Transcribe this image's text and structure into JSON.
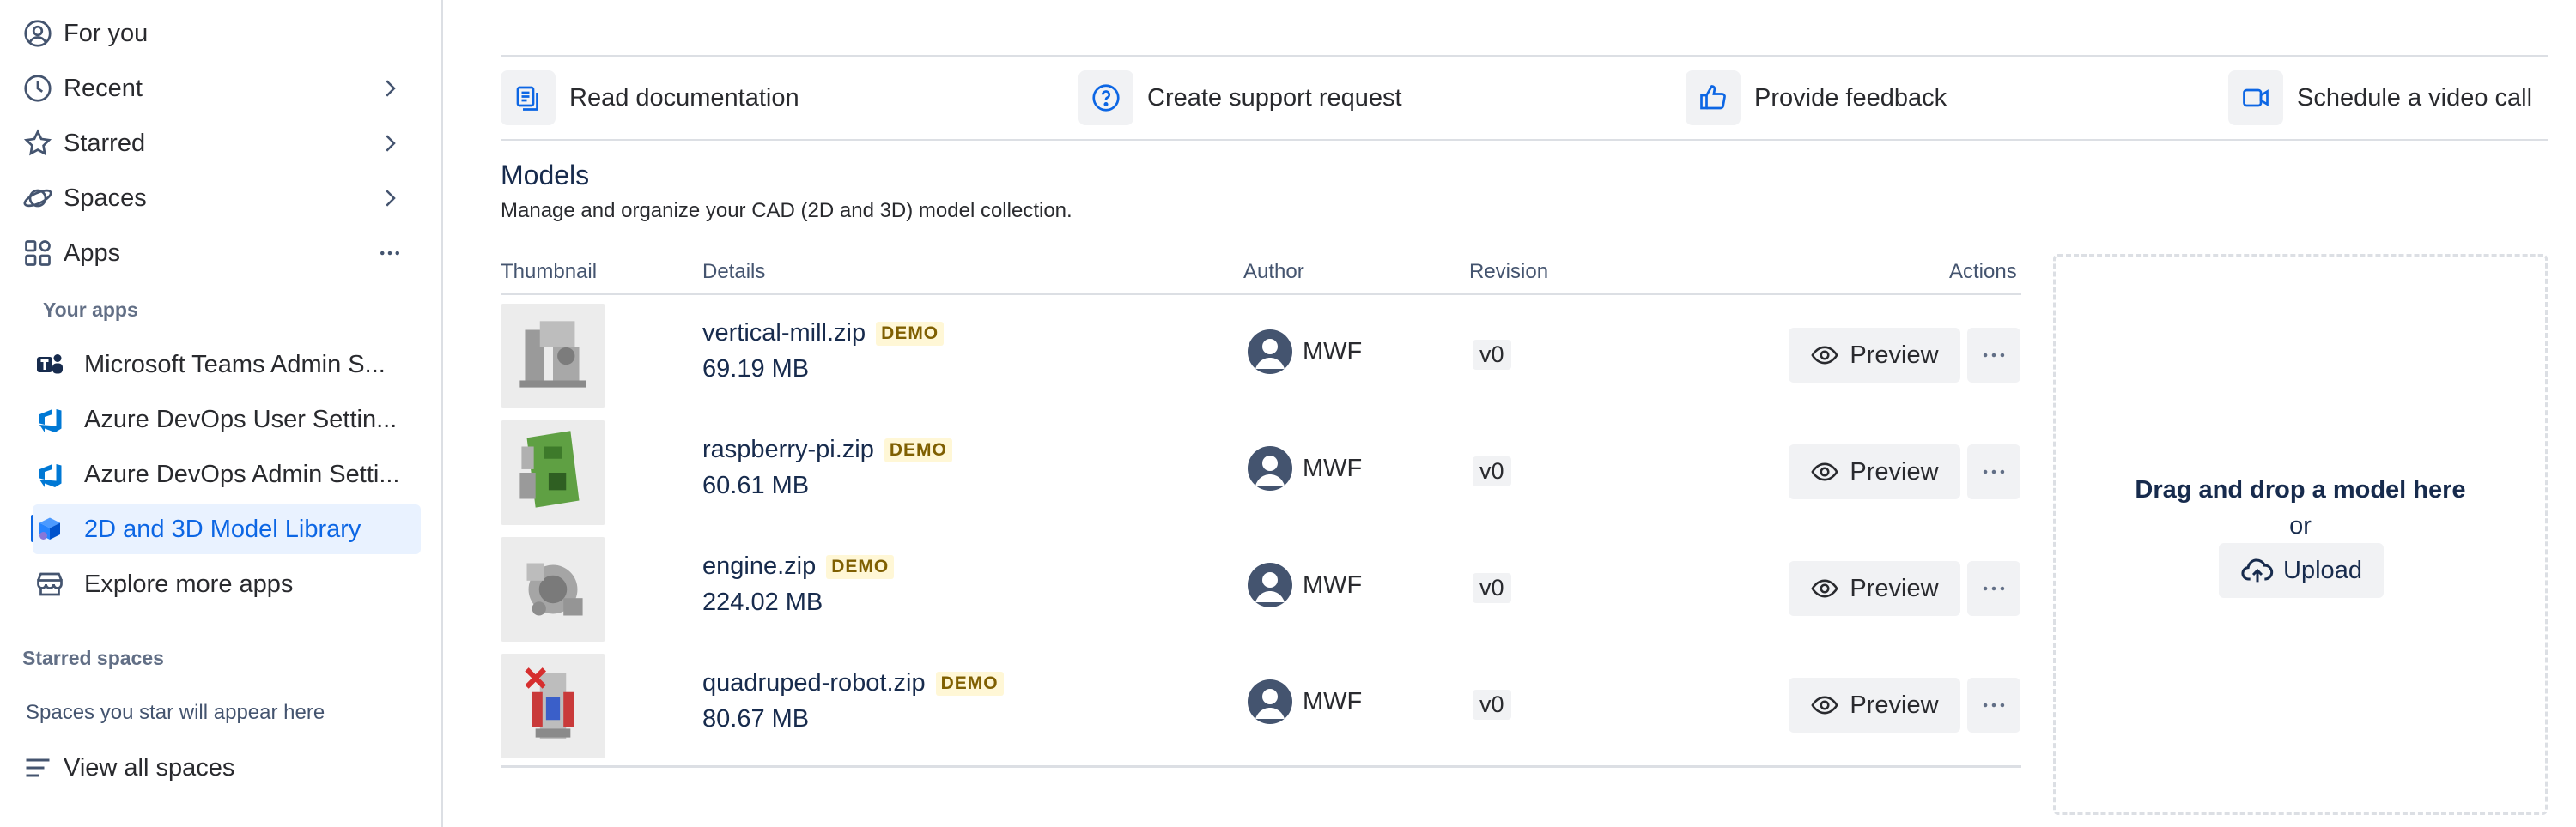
{
  "sidebar": {
    "items": [
      {
        "label": "For you",
        "icon": "user-circle-icon"
      },
      {
        "label": "Recent",
        "icon": "clock-icon"
      },
      {
        "label": "Starred",
        "icon": "star-icon"
      },
      {
        "label": "Spaces",
        "icon": "planet-icon"
      },
      {
        "label": "Apps",
        "icon": "apps-grid-icon"
      }
    ],
    "your_apps_heading": "Your apps",
    "apps": [
      {
        "label": "Microsoft Teams Admin S...",
        "icon": "teams-icon"
      },
      {
        "label": "Azure DevOps User Settin...",
        "icon": "azure-devops-icon"
      },
      {
        "label": "Azure DevOps Admin Setti...",
        "icon": "azure-devops-icon"
      },
      {
        "label": "2D and 3D Model Library",
        "icon": "model-library-icon",
        "selected": true
      },
      {
        "label": "Explore more apps",
        "icon": "store-icon"
      }
    ],
    "starred_heading": "Starred spaces",
    "starred_empty": "Spaces you star will appear here",
    "view_all": "View all spaces"
  },
  "actions": [
    {
      "label": "Read documentation",
      "icon": "documentation-icon"
    },
    {
      "label": "Create support request",
      "icon": "question-icon"
    },
    {
      "label": "Provide feedback",
      "icon": "thumbs-up-icon"
    },
    {
      "label": "Schedule a video call",
      "icon": "video-icon"
    }
  ],
  "models": {
    "title": "Models",
    "subtitle": "Manage and organize your CAD (2D and 3D) model collection.",
    "columns": {
      "thumbnail": "Thumbnail",
      "details": "Details",
      "author": "Author",
      "revision": "Revision",
      "actions": "Actions"
    },
    "rows": [
      {
        "name": "vertical-mill.zip",
        "badge": "DEMO",
        "size": "69.19 MB",
        "author": "MWF",
        "revision": "v0",
        "preview": "Preview"
      },
      {
        "name": "raspberry-pi.zip",
        "badge": "DEMO",
        "size": "60.61 MB",
        "author": "MWF",
        "revision": "v0",
        "preview": "Preview"
      },
      {
        "name": "engine.zip",
        "badge": "DEMO",
        "size": "224.02 MB",
        "author": "MWF",
        "revision": "v0",
        "preview": "Preview"
      },
      {
        "name": "quadruped-robot.zip",
        "badge": "DEMO",
        "size": "80.67 MB",
        "author": "MWF",
        "revision": "v0",
        "preview": "Preview"
      }
    ]
  },
  "dropzone": {
    "title": "Drag and drop a model here",
    "or": "or",
    "upload": "Upload"
  },
  "colors": {
    "accent": "#0c66e4",
    "selected_bg": "#e9f2ff",
    "badge_bg": "#fff7d6",
    "badge_text": "#7f5f01"
  }
}
